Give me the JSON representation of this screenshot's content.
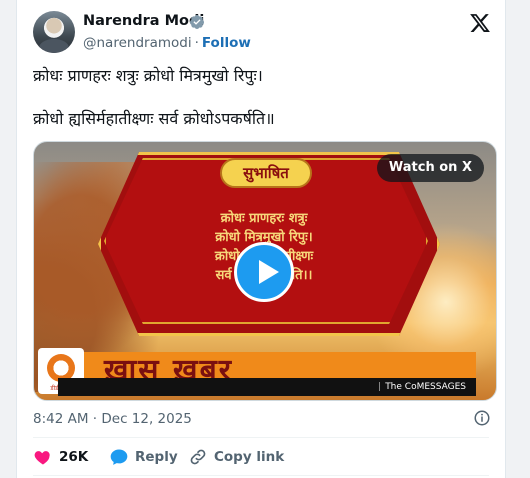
{
  "author": {
    "name": "Narendra Modi",
    "handle": "@narendramodi",
    "separator": "·",
    "follow_label": "Follow"
  },
  "post": {
    "line1": "क्रोधः प्राणहरः शत्रुः क्रोधो मित्रमुखो रिपुः।",
    "line2": "क्रोधो ह्यसिर्महातीक्ष्णः सर्व क्रोधोऽपकर्षति॥"
  },
  "media": {
    "badge": "सुभाषित",
    "verse_lines": [
      "क्रोधः प्राणहरः शत्रुः",
      "क्रोधो मित्रमुखो रिपुः।",
      "क्रोधो ह्यसिर्महातीक्ष्णः",
      "सर्व क्रोधोऽपकर्षति।।"
    ],
    "watch_label": "Watch on X",
    "banner_text": "ख़ास ख़बर",
    "logo_label": "डीडी न्यूज़",
    "ticker_sep": "|",
    "ticker_text": "The Co",
    "ticker_messages": "MESSAGES"
  },
  "meta": {
    "timestamp": "8:42 AM · Dec 12, 2025"
  },
  "actions": {
    "likes": "26K",
    "reply_label": "Reply",
    "copy_label": "Copy link"
  },
  "colors": {
    "accent": "#1d9bf0",
    "like": "#f91880",
    "follow": "#1d6fb5"
  }
}
